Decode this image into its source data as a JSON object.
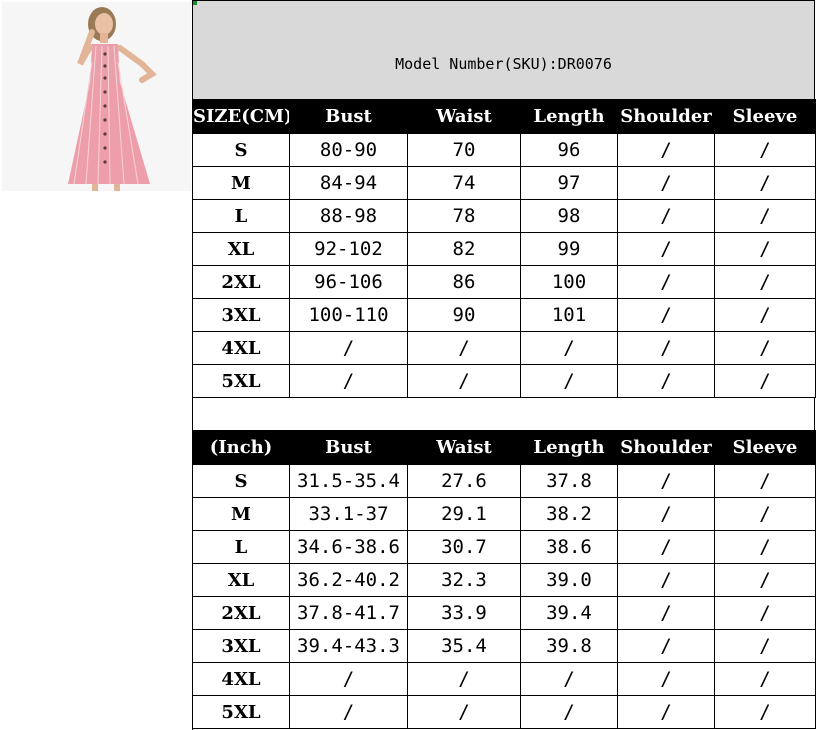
{
  "product": {
    "model_line": "Model Number(SKU):DR0076"
  },
  "cm_table": {
    "headers": [
      "SIZE(CM)",
      "Bust",
      "Waist",
      "Length",
      "Shoulder",
      "Sleeve"
    ],
    "rows": [
      [
        "S",
        "80-90",
        "70",
        "96",
        "/",
        "/"
      ],
      [
        "M",
        "84-94",
        "74",
        "97",
        "/",
        "/"
      ],
      [
        "L",
        "88-98",
        "78",
        "98",
        "/",
        "/"
      ],
      [
        "XL",
        "92-102",
        "82",
        "99",
        "/",
        "/"
      ],
      [
        "2XL",
        "96-106",
        "86",
        "100",
        "/",
        "/"
      ],
      [
        "3XL",
        "100-110",
        "90",
        "101",
        "/",
        "/"
      ],
      [
        "4XL",
        "/",
        "/",
        "/",
        "/",
        "/"
      ],
      [
        "5XL",
        "/",
        "/",
        "/",
        "/",
        "/"
      ]
    ]
  },
  "inch_table": {
    "headers": [
      "(Inch)",
      "Bust",
      "Waist",
      "Length",
      "Shoulder",
      "Sleeve"
    ],
    "rows": [
      [
        "S",
        "31.5-35.4",
        "27.6",
        "37.8",
        "/",
        "/"
      ],
      [
        "M",
        "33.1-37",
        "29.1",
        "38.2",
        "/",
        "/"
      ],
      [
        "L",
        "34.6-38.6",
        "30.7",
        "38.6",
        "/",
        "/"
      ],
      [
        "XL",
        "36.2-40.2",
        "32.3",
        "39.0",
        "/",
        "/"
      ],
      [
        "2XL",
        "37.8-41.7",
        "33.9",
        "39.4",
        "/",
        "/"
      ],
      [
        "3XL",
        "39.4-43.3",
        "35.4",
        "39.8",
        "/",
        "/"
      ],
      [
        "4XL",
        "/",
        "/",
        "/",
        "/",
        "/"
      ],
      [
        "5XL",
        "/",
        "/",
        "/",
        "/",
        "/"
      ]
    ]
  }
}
